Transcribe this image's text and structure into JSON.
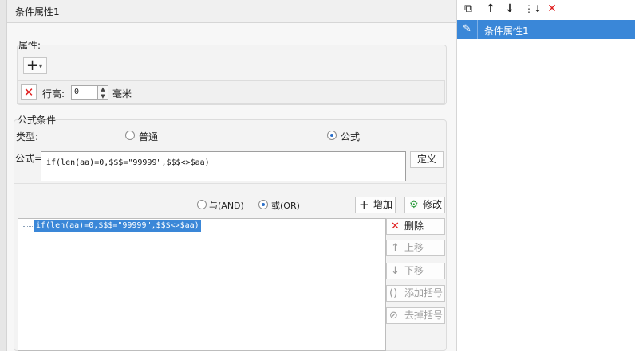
{
  "dialog": {
    "title": "条件属性1"
  },
  "properties": {
    "section_label": "属性:",
    "add_button_icon": "plus-icon",
    "row_height": {
      "label": "行高:",
      "value": "0",
      "unit": "毫米"
    }
  },
  "formula_condition": {
    "section_label": "公式条件",
    "type_label": "类型:",
    "type_options": [
      {
        "label": "普通",
        "selected": false
      },
      {
        "label": "公式",
        "selected": true
      }
    ],
    "formula_label": "公式=",
    "formula_value": "if(len(aa)=0,$$$=\"99999\",$$$<>$aa)",
    "define_button": "定义",
    "logic_options": [
      {
        "label": "与(AND)",
        "selected": false
      },
      {
        "label": "或(OR)",
        "selected": true
      }
    ],
    "add_button": "增加",
    "modify_button": "修改",
    "list_items": [
      "if(len(aa)=0,$$$=\"99999\",$$$<>$aa)"
    ],
    "side_buttons": {
      "delete": "删除",
      "move_up": "上移",
      "move_down": "下移",
      "add_brackets": "添加括号",
      "remove_brackets": "去掉括号"
    }
  },
  "right_panel": {
    "toolbar_icons": [
      "copy-icon",
      "arrow-up-icon",
      "arrow-down-icon",
      "sort-down-icon",
      "close-icon"
    ],
    "conditions": [
      {
        "name": "条件属性1",
        "selected": true
      }
    ]
  },
  "colors": {
    "accent": "#3a87d8",
    "delete_red": "#e02020"
  }
}
